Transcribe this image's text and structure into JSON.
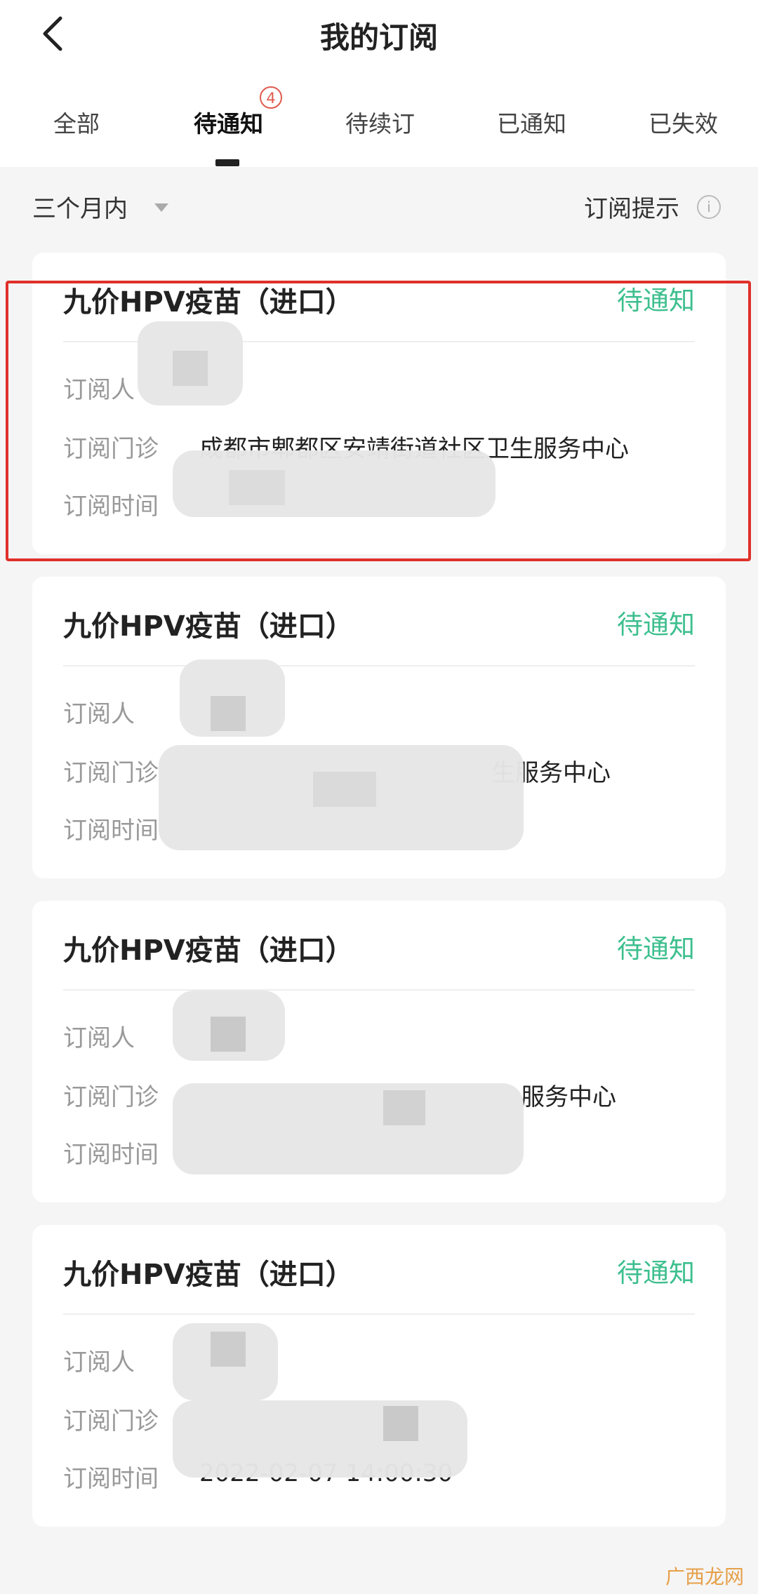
{
  "header": {
    "title": "我的订阅",
    "tabs": [
      {
        "label": "全部"
      },
      {
        "label": "待通知",
        "badge": "4",
        "active": true
      },
      {
        "label": "待续订"
      },
      {
        "label": "已通知"
      },
      {
        "label": "已失效"
      }
    ]
  },
  "filter": {
    "range": "三个月内",
    "tip": "订阅提示",
    "info_glyph": "i"
  },
  "labels": {
    "subscriber": "订阅人",
    "clinic": "订阅门诊",
    "time": "订阅时间"
  },
  "cards": [
    {
      "title": "九价HPV疫苗（进口）",
      "status": "待通知",
      "clinic": "成都市郫都区安靖街道社区卫生服务中心",
      "time": ""
    },
    {
      "title": "九价HPV疫苗（进口）",
      "status": "待通知",
      "clinic": "生服务中心",
      "time": ""
    },
    {
      "title": "九价HPV疫苗（进口）",
      "status": "待通知",
      "clinic": "服务中心",
      "time": ""
    },
    {
      "title": "九价HPV疫苗（进口）",
      "status": "待通知",
      "clinic": "",
      "time": "2022-02-07 14:00:30"
    }
  ],
  "colors": {
    "accent": "#3dbf8e",
    "highlight": "#e0302a",
    "badge": "#e05a4e"
  },
  "watermark": "广西龙网"
}
